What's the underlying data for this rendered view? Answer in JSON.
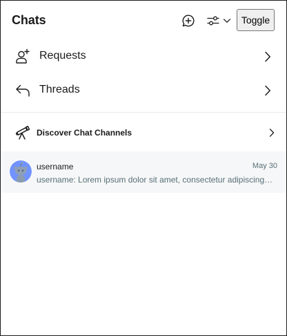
{
  "header": {
    "title": "Chats",
    "new_chat_icon": "chat-plus-icon",
    "filter_icon": "sliders-icon",
    "filter_caret_icon": "chevron-down-icon",
    "toggle_label": "Toggle"
  },
  "nav": {
    "items": [
      {
        "label": "Requests",
        "icon": "user-add-icon"
      },
      {
        "label": "Threads",
        "icon": "reply-icon"
      }
    ]
  },
  "discover": {
    "label": "Discover Chat Channels",
    "icon": "telescope-icon"
  },
  "chats": [
    {
      "username": "username",
      "date": "May 30",
      "preview": "username: Lorem ipsum dolor sit amet, consectetur adipiscing elit, sed do eiusmod tempor incididunt ut labore",
      "avatar_color": "#7193ff"
    }
  ],
  "colors": {
    "text": "#1a1a1b",
    "muted": "#576f76",
    "row_highlight": "#f6f7f8",
    "divider": "#e9e9e9"
  }
}
